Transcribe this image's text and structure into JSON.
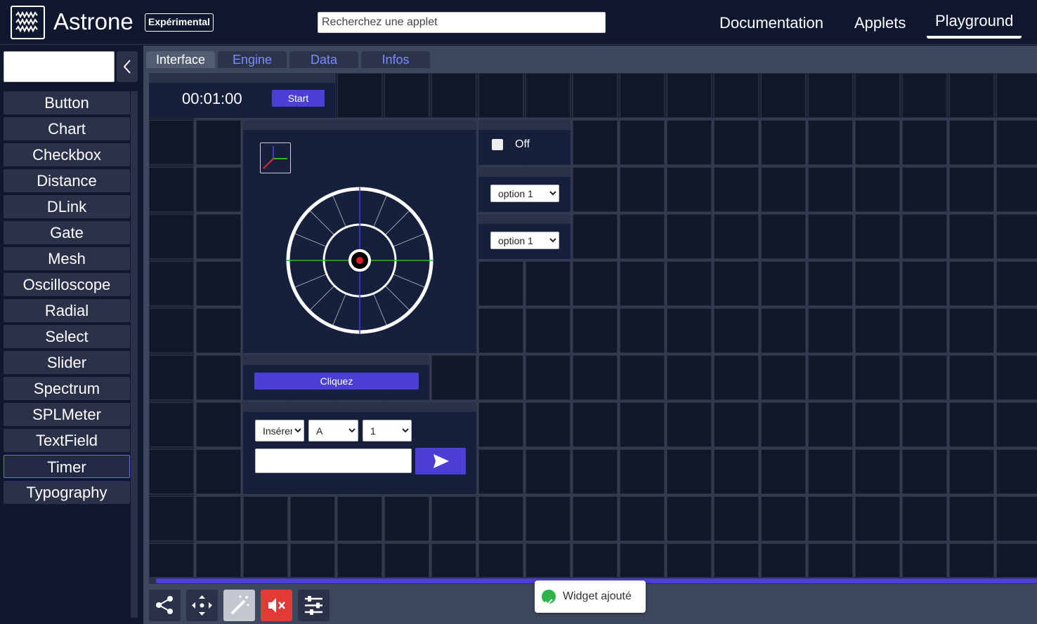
{
  "header": {
    "brand": "Astrone",
    "badge": "Expérimental",
    "search_placeholder": "Recherchez une applet",
    "nav": {
      "documentation": "Documentation",
      "applets": "Applets",
      "playground": "Playground"
    }
  },
  "sidebar": {
    "collapse_icon": "chevron-left-icon",
    "widgets": [
      "Button",
      "Chart",
      "Checkbox",
      "Distance",
      "DLink",
      "Gate",
      "Mesh",
      "Oscilloscope",
      "Radial",
      "Select",
      "Slider",
      "Spectrum",
      "SPLMeter",
      "TextField",
      "Timer",
      "Typography"
    ],
    "active_widget": "Timer"
  },
  "tabs": [
    "Interface",
    "Engine",
    "Data",
    "Infos"
  ],
  "active_tab": "Interface",
  "timer": {
    "time": "00:01:00",
    "start_label": "Start"
  },
  "checkbox": {
    "label": "Off",
    "checked": false
  },
  "select_1": {
    "value": "option 1"
  },
  "select_2": {
    "value": "option 1"
  },
  "button": {
    "label": "Cliquez"
  },
  "textfield": {
    "mode": "Insérer",
    "letter": "A",
    "number": "1",
    "value": ""
  },
  "toolbar": {
    "icons": [
      "share-icon",
      "move-icon",
      "magic-wand-icon",
      "mute-icon",
      "sliders-icon"
    ]
  },
  "toast": {
    "message": "Widget ajouté"
  },
  "colors": {
    "accent": "#4b3fd6",
    "background": "#101830",
    "mute": "#e53935"
  }
}
